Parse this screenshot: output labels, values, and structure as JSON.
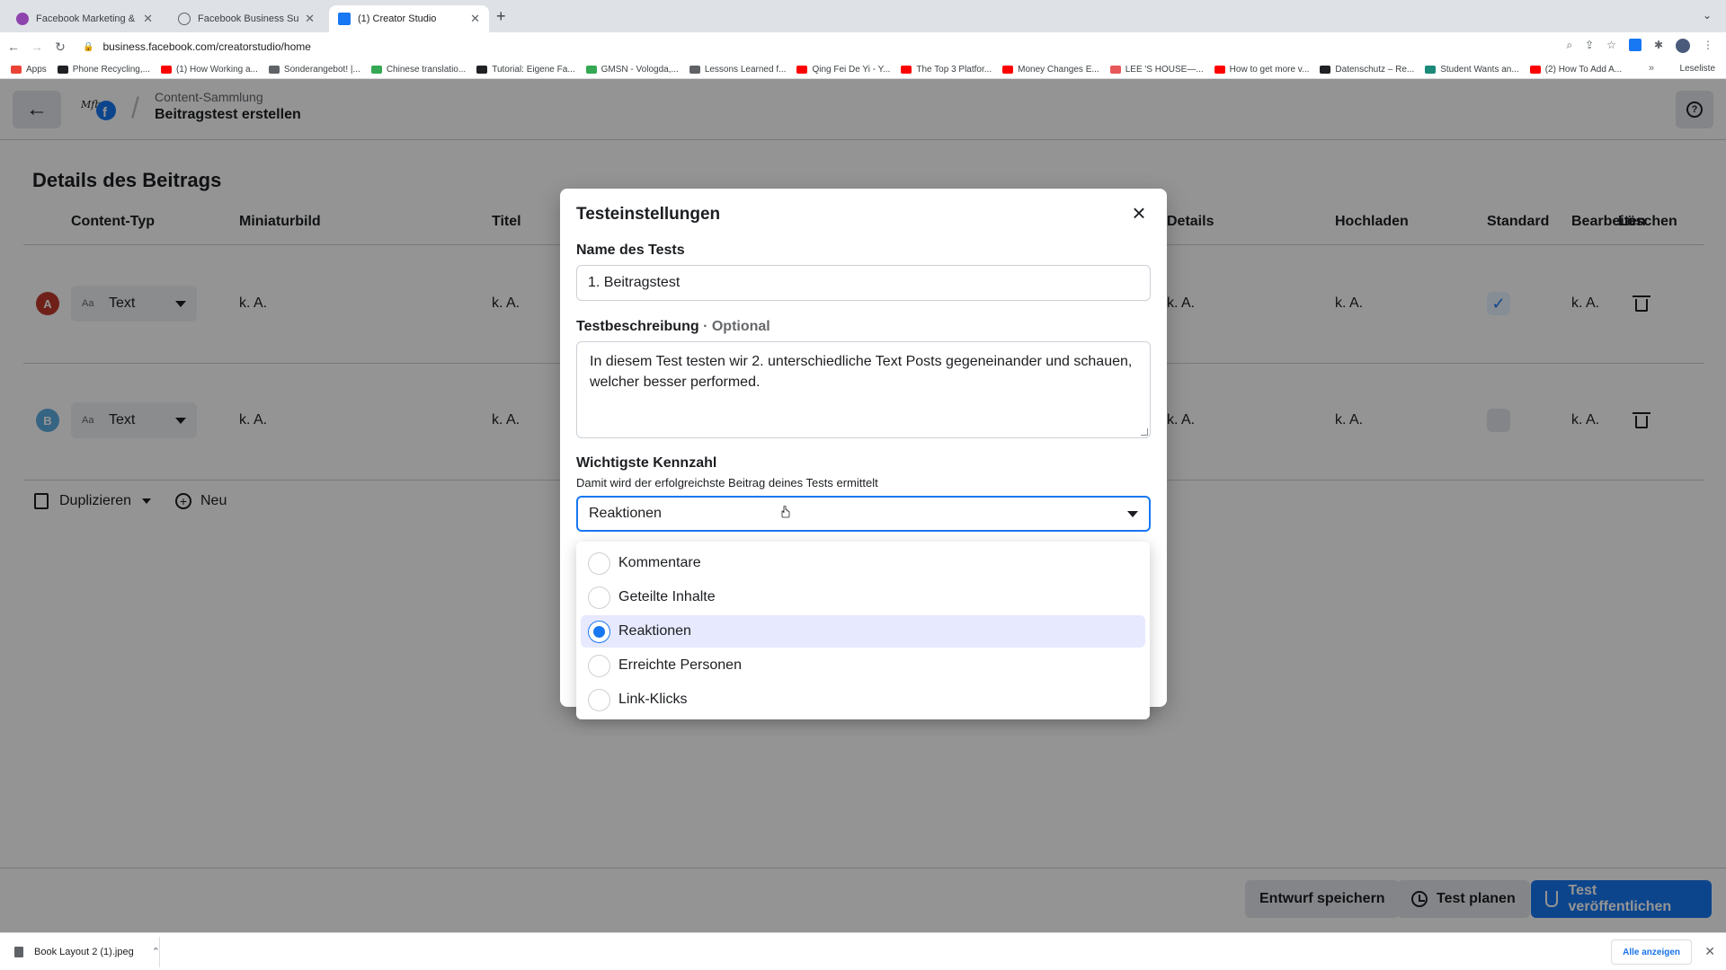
{
  "browser": {
    "tabs": [
      {
        "title": "Facebook Marketing & Werbeanz",
        "favicon_color": "#8e44ad"
      },
      {
        "title": "Facebook Business Suite",
        "favicon_color": "#5f6368"
      },
      {
        "title": "(1) Creator Studio",
        "favicon_color": "#1877f2"
      }
    ],
    "url": "business.facebook.com/creatorstudio/home",
    "bookmarks": [
      {
        "label": "Apps",
        "color": "#ea4335"
      },
      {
        "label": "Phone Recycling,...",
        "color": "#202124"
      },
      {
        "label": "(1) How Working a...",
        "color": "#ff0000"
      },
      {
        "label": "Sonderangebot! |...",
        "color": "#5f6368"
      },
      {
        "label": "Chinese translatio...",
        "color": "#34a853"
      },
      {
        "label": "Tutorial: Eigene Fa...",
        "color": "#202124"
      },
      {
        "label": "GMSN - Vologda,...",
        "color": "#34a853"
      },
      {
        "label": "Lessons Learned f...",
        "color": "#5f6368"
      },
      {
        "label": "Qing Fei De Yi - Y...",
        "color": "#ff0000"
      },
      {
        "label": "The Top 3 Platfor...",
        "color": "#ff0000"
      },
      {
        "label": "Money Changes E...",
        "color": "#ff0000"
      },
      {
        "label": "LEE 'S HOUSE—...",
        "color": "#e8575a"
      },
      {
        "label": "How to get more v...",
        "color": "#ff0000"
      },
      {
        "label": "Datenschutz – Re...",
        "color": "#202124"
      },
      {
        "label": "Student Wants an...",
        "color": "#1a8a7a"
      },
      {
        "label": "(2) How To Add A...",
        "color": "#ff0000"
      }
    ],
    "reading_list": "Leseliste"
  },
  "header": {
    "breadcrumb": "Content-Sammlung",
    "title": "Beitragstest erstellen"
  },
  "details": {
    "title": "Details des Beitrags",
    "columns": {
      "content_type": "Content-Typ",
      "thumbnail": "Miniaturbild",
      "title": "Titel",
      "details": "Details",
      "upload": "Hochladen",
      "standard": "Standard",
      "edit": "Bearbeiten",
      "delete": "Löschen"
    },
    "rows": [
      {
        "variant": "A",
        "variant_color": "#c0392b",
        "content_type": "Text",
        "type_icon": "Aa",
        "thumbnail": "k. A.",
        "title": "k. A.",
        "details": "k. A.",
        "upload": "k. A.",
        "standard": true,
        "edit": "k. A."
      },
      {
        "variant": "B",
        "variant_color": "#5dade2",
        "content_type": "Text",
        "type_icon": "Aa",
        "thumbnail": "k. A.",
        "title": "k. A.",
        "details": "k. A.",
        "upload": "k. A.",
        "standard": false,
        "edit": "k. A."
      }
    ],
    "duplicate_label": "Duplizieren",
    "new_label": "Neu"
  },
  "footer": {
    "save_draft": "Entwurf speichern",
    "schedule": "Test planen",
    "publish": "Test veröffentlichen"
  },
  "modal": {
    "title": "Testeinstellungen",
    "name_label": "Name des Tests",
    "name_value": "1. Beitragstest",
    "desc_label": "Testbeschreibung",
    "desc_optional": "· Optional",
    "desc_value": "In diesem Test testen wir 2. unterschiedliche Text Posts gegeneinander und schauen, welcher besser performed.",
    "metric_label": "Wichtigste Kennzahl",
    "metric_hint": "Damit wird der erfolgreichste Beitrag deines Tests ermittelt",
    "metric_value": "Reaktionen",
    "options": [
      {
        "label": "Kommentare",
        "selected": false
      },
      {
        "label": "Geteilte Inhalte",
        "selected": false
      },
      {
        "label": "Reaktionen",
        "selected": true
      },
      {
        "label": "Erreichte Personen",
        "selected": false
      },
      {
        "label": "Link-Klicks",
        "selected": false
      }
    ]
  },
  "downloads": {
    "file": "Book Layout 2 (1).jpeg",
    "show_all": "Alle anzeigen"
  }
}
